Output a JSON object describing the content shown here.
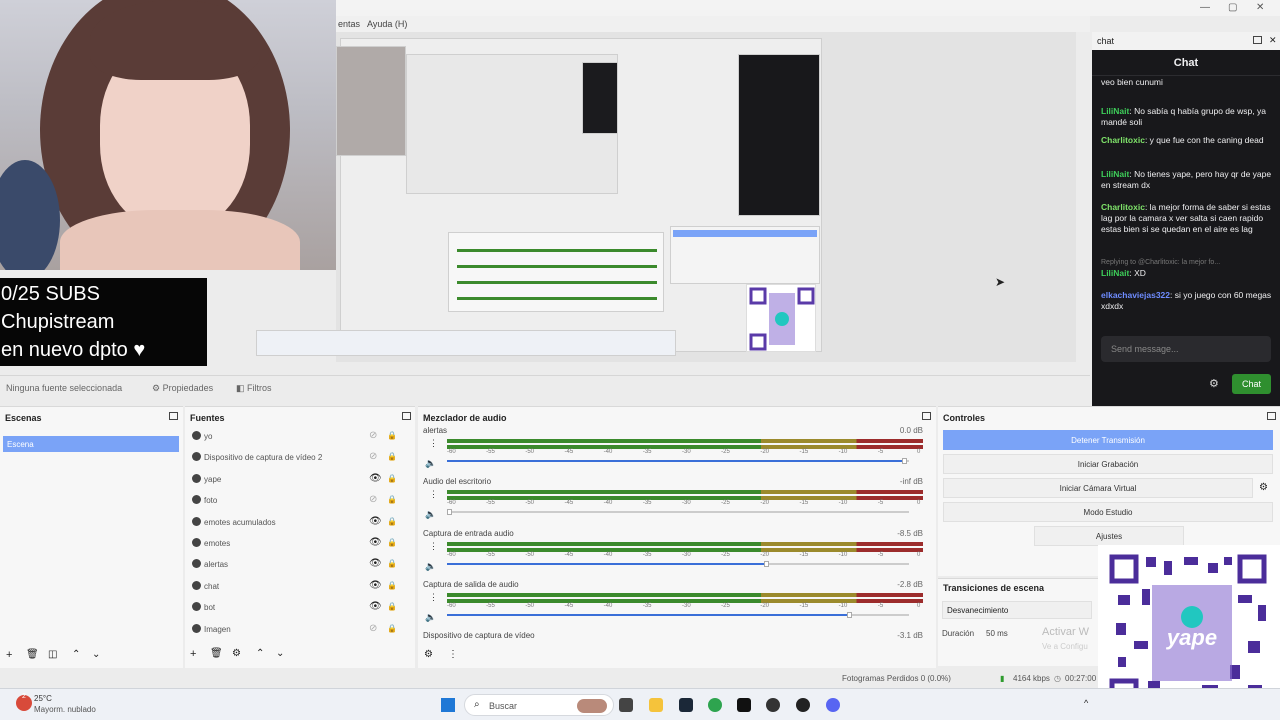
{
  "menubar": {
    "item_partial": "entas",
    "item_help": "Ayuda (H)"
  },
  "overlay": {
    "subs_line1": "0/25 SUBS",
    "subs_line2": "Chupistream",
    "subs_line3": "en nuevo dpto ♥"
  },
  "toolbar": {
    "no_source": "Ninguna fuente seleccionada",
    "properties": "Propiedades",
    "filters": "Filtros"
  },
  "scenes": {
    "title": "Escenas",
    "items": [
      "Escena"
    ]
  },
  "sources": {
    "title": "Fuentes",
    "items": [
      {
        "label": "yo",
        "visible": false,
        "locked": true
      },
      {
        "label": "Dispositivo de captura de vídeo 2",
        "visible": false,
        "locked": true
      },
      {
        "label": "yape",
        "visible": true,
        "locked": true
      },
      {
        "label": "foto",
        "visible": false,
        "locked": true
      },
      {
        "label": "emotes acumulados",
        "visible": true,
        "locked": true
      },
      {
        "label": "emotes",
        "visible": true,
        "locked": true
      },
      {
        "label": "alertas",
        "visible": true,
        "locked": true
      },
      {
        "label": "chat",
        "visible": true,
        "locked": true
      },
      {
        "label": "bot",
        "visible": true,
        "locked": true
      },
      {
        "label": "Imagen",
        "visible": false,
        "locked": true
      }
    ]
  },
  "mixer": {
    "title": "Mezclador de audio",
    "ticks": [
      "-60",
      "-55",
      "-50",
      "-45",
      "-40",
      "-35",
      "-30",
      "-25",
      "-20",
      "-15",
      "-10",
      "-5",
      "0"
    ],
    "channels": [
      {
        "name": "alertas",
        "db": "0.0 dB",
        "volume": 0.99
      },
      {
        "name": "Audio del escritorio",
        "db": "-inf dB",
        "volume": 0.0
      },
      {
        "name": "Captura de entrada audio",
        "db": "-8.5 dB",
        "volume": 0.69
      },
      {
        "name": "Captura de salida de audio",
        "db": "-2.8 dB",
        "volume": 0.87
      },
      {
        "name": "Dispositivo de captura de vídeo",
        "db": "-3.1 dB"
      }
    ]
  },
  "controls": {
    "title": "Controles",
    "stop_stream": "Detener Transmisión",
    "start_recording": "Iniciar Grabación",
    "start_virtual_cam": "Iniciar Cámara Virtual",
    "studio_mode": "Modo Estudio",
    "settings": "Ajustes"
  },
  "transitions": {
    "title": "Transiciones de escena",
    "selected": "Desvanecimiento",
    "duration_label": "Duración",
    "duration_value": "50 ms"
  },
  "watermark": {
    "line1": "Activar W",
    "line2": "Ve a Configu"
  },
  "chat": {
    "dock_title": "chat",
    "header": "Chat",
    "messages": [
      {
        "user": "",
        "text": "veo bien cunumi",
        "color": ""
      },
      {
        "user": "LiliNait",
        "text": "No sabía q había grupo de wsp, ya mandé soli",
        "color": "#3ecf5a"
      },
      {
        "user": "Charlitoxic",
        "text": "y que fue con the caning dead",
        "color": "#7fe36a"
      },
      {
        "user": "LiliNait",
        "text": "No tienes yape, pero hay qr de yape en stream dx",
        "color": "#3ecf5a"
      },
      {
        "user": "Charlitoxic",
        "text": "la mejor forma de saber si estas lag por la camara x ver salta si caen rapido estas bien si se quedan en el aire es lag",
        "color": "#7fe36a"
      },
      {
        "user": "LiliNait",
        "text": "XD",
        "color": "#3ecf5a",
        "reply": "Replying to @Charlitoxic: la mejor fo..."
      },
      {
        "user": "elkachaviejas322",
        "text": "si yo juego con 60 megas xdxdx",
        "color": "#6e8cff"
      }
    ],
    "input_placeholder": "Send message...",
    "chat_button": "Chat"
  },
  "status": {
    "frames_dropped": "Fotogramas Perdidos 0 (0.0%)",
    "bitrate": "4164 kbps",
    "time": "00:27:00"
  },
  "taskbar": {
    "weather_temp": "25°C",
    "weather_desc": "Mayorm. nublado",
    "search": "Buscar",
    "badge": "2"
  }
}
